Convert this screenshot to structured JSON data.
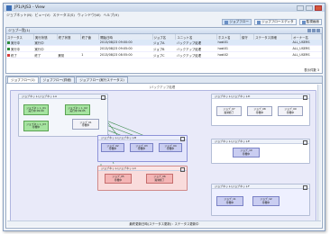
{
  "app": {
    "title": "JP1/AJS3 - View"
  },
  "menu": [
    "ジョブネット(N)",
    "ビュー(V)",
    "ステータス(S)",
    "ウィンドウ(W)",
    "ヘルプ(H)"
  ],
  "toolbar": {
    "buttons": [
      {
        "label": "ジョブフロー"
      },
      {
        "label": "ジョブフローエディタ"
      },
      {
        "label": "監視画面"
      }
    ]
  },
  "job_list": {
    "title": "ジョブ一覧(1)",
    "total_label": "表示件数 3",
    "columns": [
      "ステータス",
      "実行状態",
      "終了状態",
      "終了値",
      "開始日時",
      "ジョブ名",
      "ユニット名",
      "ホスト名",
      "保守",
      "ステータス詳細",
      "オーナー名"
    ],
    "rows": [
      {
        "status": "実行中",
        "state": "実行中",
        "end": "",
        "code": "",
        "start": "2013/08/23 09:00:00",
        "job": "ジョブA",
        "unit": "バックアップ処理",
        "host": "host01",
        "maint": "",
        "detail": "",
        "owner": "ALL_USERS",
        "color": "#2e8b3a"
      },
      {
        "status": "実行中",
        "state": "実行中",
        "end": "",
        "code": "",
        "start": "2013/08/23 09:05:00",
        "job": "ジョブB",
        "unit": "バックアップ処理",
        "host": "host01",
        "maint": "",
        "detail": "",
        "owner": "ALL_USERS",
        "color": "#2e8b3a"
      },
      {
        "status": "終了",
        "state": "終了",
        "end": "異常",
        "code": "1",
        "start": "2013/08/23 08:55:00",
        "job": "ジョブC",
        "unit": "バックアップ処理",
        "host": "host02",
        "maint": "",
        "detail": "",
        "owner": "ALL_USERS",
        "color": "#d43b3b"
      }
    ]
  },
  "flow_view": {
    "tabs": [
      {
        "label": "ジョブフロー(1)"
      },
      {
        "label": "ジョブフロー(詳細)"
      },
      {
        "label": "ジョブフロー(実行ステータス)"
      }
    ],
    "canvas_title": "/バックアップ処理",
    "nets": [
      {
        "title": "ジョブネット/ジョブネットA"
      },
      {
        "title": "ジョブネット/ジョブネットB"
      },
      {
        "title": "ジョブネット/ジョブネットC"
      },
      {
        "title": "ジョブネット/ジョブネットD"
      },
      {
        "title": "ジョブネット/ジョブネットE"
      },
      {
        "title": "ジョブネット/ジョブネットF"
      }
    ],
    "jobs": [
      {
        "name": "ジョブネット_01",
        "sub": "実行中 09:00"
      },
      {
        "name": "ジョブネット_02",
        "sub": "実行中 09:05"
      },
      {
        "name": "ジョブネット_03",
        "sub": "待機中"
      },
      {
        "name": "ジョブ_01",
        "sub": "待機中"
      },
      {
        "name": "ジョブ_02",
        "sub": "待機中"
      },
      {
        "name": "ジョブ_03",
        "sub": "待機中"
      },
      {
        "name": "ジョブ_04",
        "sub": "待機中"
      },
      {
        "name": "ジョブ_05",
        "sub": "待機中"
      },
      {
        "name": "ジョブ_06",
        "sub": "異常終了"
      },
      {
        "name": "ジョブ_07",
        "sub": "異常終了"
      },
      {
        "name": "ジョブ_08",
        "sub": "待機中"
      },
      {
        "name": "ジョブ_09",
        "sub": "待機中"
      },
      {
        "name": "ジョブ_10",
        "sub": "待機中"
      },
      {
        "name": "ジョブ_11",
        "sub": "待機中"
      },
      {
        "name": "ジョブ_12",
        "sub": "待機中"
      }
    ],
    "status": "最終更新日時(ステータス更新) : ステータス更新中"
  }
}
